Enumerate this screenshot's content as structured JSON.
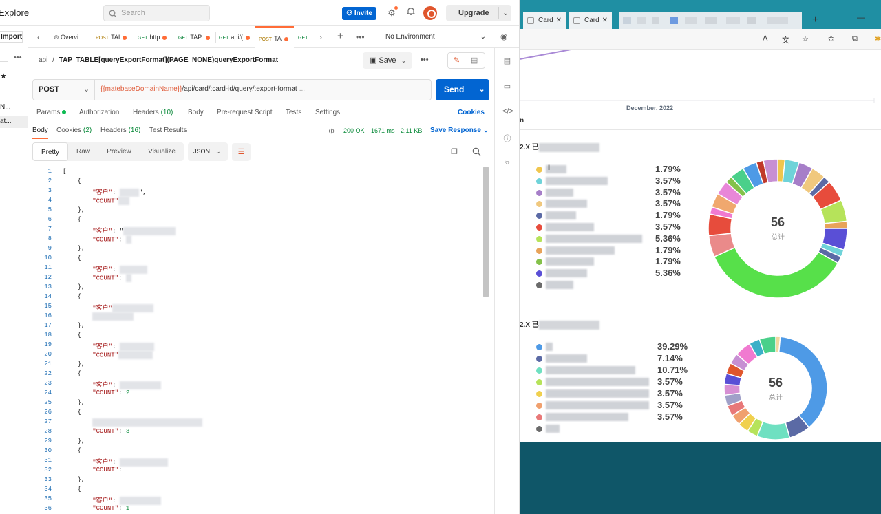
{
  "postman": {
    "header": {
      "explore": "Explore",
      "search_placeholder": "Search",
      "invite": "Invite",
      "upgrade": "Upgrade"
    },
    "sidebar": {
      "import": "Import",
      "item1": "N...",
      "item2": "at..."
    },
    "tabs": [
      {
        "method": "",
        "label": "Overvi"
      },
      {
        "method": "POST",
        "label": "TAI"
      },
      {
        "method": "GET",
        "label": "http"
      },
      {
        "method": "GET",
        "label": "TAP."
      },
      {
        "method": "GET",
        "label": "api/("
      },
      {
        "method": "POST",
        "label": "TA"
      },
      {
        "method": "GET",
        "label": ""
      }
    ],
    "environment": "No Environment",
    "breadcrumb": {
      "collection": "api",
      "sep": "/",
      "request": "TAP_TABLE[queryExportFormat](PAGE_NONE)queryExportFormat"
    },
    "save": "Save",
    "request": {
      "method": "POST",
      "url_var": "{{matebaseDomainName}}",
      "url_path": "/api/card/:card-id/query/:export-format",
      "url_tail": "...",
      "send": "Send"
    },
    "request_tabs": {
      "params": "Params",
      "authorization": "Authorization",
      "headers": "Headers",
      "headers_count": "(10)",
      "body": "Body",
      "prerequest": "Pre-request Script",
      "tests": "Tests",
      "settings": "Settings",
      "cookies": "Cookies"
    },
    "response_tabs": {
      "body": "Body",
      "cookies": "Cookies",
      "cookies_count": "(2)",
      "headers": "Headers",
      "headers_count": "(16)",
      "test_results": "Test Results"
    },
    "response_status": {
      "status": "200 OK",
      "time": "1671 ms",
      "size": "2.11 KB",
      "save_response": "Save Response"
    },
    "view_modes": {
      "pretty": "Pretty",
      "raw": "Raw",
      "preview": "Preview",
      "visualize": "Visualize",
      "format": "JSON"
    },
    "code": {
      "key_customer": "\"客户\"",
      "key_count": "\"COUNT\"",
      "open_bracket": "[",
      "open_brace": "{",
      "close_brace": "},",
      "colon": ": ",
      "comma": ",",
      "count_vals": [
        "2",
        "3",
        "1"
      ],
      "frag_quote": "\",",
      "frag_dq": "\"",
      "frag_1": "1",
      "frag_sep": ";"
    }
  },
  "browser": {
    "tabs": [
      {
        "label": "Card"
      },
      {
        "label": "Card"
      }
    ],
    "chart_axis_label": "December, 2022",
    "section_fragment": "n",
    "chart1": {
      "title_prefix": "2.X 已",
      "total": "56",
      "total_label": "总计",
      "percentages": [
        "1.79%",
        "3.57%",
        "3.57%",
        "3.57%",
        "1.79%",
        "3.57%",
        "5.36%",
        "1.79%",
        "1.79%",
        "5.36%"
      ],
      "legend_fragment": "I",
      "colors": [
        "#f0c64e",
        "#6fd3d9",
        "#a67ec8",
        "#f0c87e",
        "#5b6aa5",
        "#e74c3c",
        "#b6e35a",
        "#e8a35a",
        "#84c14a",
        "#5a4fd6",
        "#6b6b6b"
      ]
    },
    "chart2": {
      "title_prefix": "2.X 已",
      "total": "56",
      "total_label": "总计",
      "percentages": [
        "39.29%",
        "7.14%",
        "10.71%",
        "3.57%",
        "3.57%",
        "3.57%",
        "3.57%"
      ],
      "colors": [
        "#4e9ae6",
        "#5b6aa5",
        "#6fe0c1",
        "#b6e35a",
        "#f0d04e",
        "#f0a06e",
        "#e87878",
        "#6b6b6b"
      ]
    },
    "chart_data": [
      {
        "type": "pie",
        "title": "",
        "total": 56,
        "values": [
          1.79,
          3.57,
          3.57,
          3.57,
          1.79,
          3.57,
          5.36,
          1.79,
          1.79,
          5.36
        ]
      },
      {
        "type": "pie",
        "title": "",
        "total": 56,
        "values": [
          39.29,
          7.14,
          10.71,
          3.57,
          3.57,
          3.57,
          3.57
        ]
      }
    ]
  }
}
